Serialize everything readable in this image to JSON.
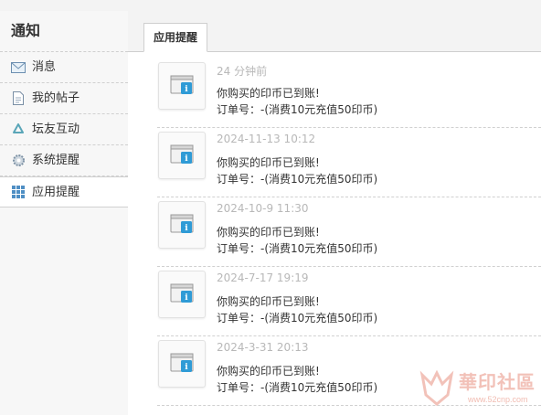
{
  "sidebar": {
    "title": "通知",
    "items": [
      {
        "label": "消息",
        "icon": "mail-icon"
      },
      {
        "label": "我的帖子",
        "icon": "document-icon"
      },
      {
        "label": "坛友互动",
        "icon": "recycle-icon"
      },
      {
        "label": "系统提醒",
        "icon": "gear-icon"
      },
      {
        "label": "应用提醒",
        "icon": "grid-icon",
        "active": true
      }
    ]
  },
  "tabs": [
    {
      "label": "应用提醒",
      "active": true
    }
  ],
  "notices": [
    {
      "time": "24 分钟前",
      "line1": "你购买的印币已到账!",
      "line2": "订单号：-(消费10元充值50印币)"
    },
    {
      "time": "2024-11-13 10:12",
      "line1": "你购买的印币已到账!",
      "line2": "订单号：-(消费10元充值50印币)"
    },
    {
      "time": "2024-10-9 11:30",
      "line1": "你购买的印币已到账!",
      "line2": "订单号：-(消费10元充值50印币)"
    },
    {
      "time": "2024-7-17 19:19",
      "line1": "你购买的印币已到账!",
      "line2": "订单号：-(消费10元充值50印币)"
    },
    {
      "time": "2024-3-31 20:13",
      "line1": "你购买的印币已到账!",
      "line2": "订单号：-(消费10元充值50印币)"
    }
  ],
  "watermark": {
    "text": "華印社區",
    "url": "www.52cnp.com"
  },
  "colors": {
    "accent": "#2f9bd6",
    "muted": "#b8b8b8",
    "watermark": "#e8907f"
  }
}
